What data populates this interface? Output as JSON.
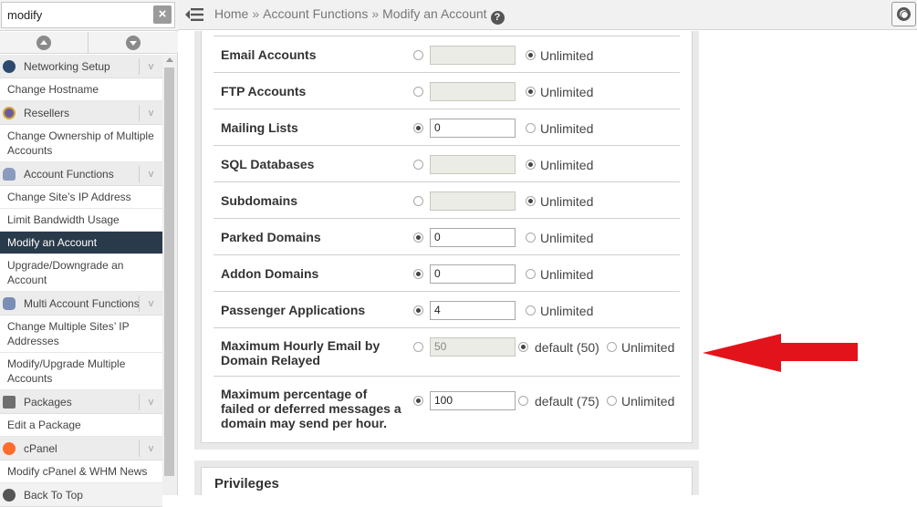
{
  "search": {
    "value": "modify",
    "clear_label": "×"
  },
  "nav": {
    "groups": [
      {
        "label": "Networking Setup",
        "icon": "networking-icon",
        "items": [
          "Change Hostname"
        ]
      },
      {
        "label": "Resellers",
        "icon": "resellers-icon",
        "items": [
          "Change Ownership of Multiple Accounts"
        ]
      },
      {
        "label": "Account Functions",
        "icon": "account-functions-icon",
        "items": [
          "Change Site’s IP Address",
          "Limit Bandwidth Usage",
          "Modify an Account",
          "Upgrade/Downgrade an Account"
        ]
      },
      {
        "label": "Multi Account Functions",
        "icon": "multi-account-icon",
        "items": [
          "Change Multiple Sites’ IP Addresses",
          "Modify/Upgrade Multiple Accounts"
        ]
      },
      {
        "label": "Packages",
        "icon": "packages-icon",
        "items": [
          "Edit a Package"
        ]
      },
      {
        "label": "cPanel",
        "icon": "cpanel-icon",
        "items": [
          "Modify cPanel & WHM News"
        ]
      }
    ],
    "active_item": "Modify an Account",
    "back_to_top": "Back To Top",
    "chevron": "v"
  },
  "breadcrumb": {
    "home": "Home",
    "section": "Account Functions",
    "page": "Modify an Account",
    "sep": "»",
    "help": "?"
  },
  "rows": [
    {
      "label": "Email Accounts",
      "choice": "unlimited",
      "value": "",
      "unlimited": "Unlimited"
    },
    {
      "label": "FTP Accounts",
      "choice": "unlimited",
      "value": "",
      "unlimited": "Unlimited"
    },
    {
      "label": "Mailing Lists",
      "choice": "value",
      "value": "0",
      "unlimited": "Unlimited"
    },
    {
      "label": "SQL Databases",
      "choice": "unlimited",
      "value": "",
      "unlimited": "Unlimited"
    },
    {
      "label": "Subdomains",
      "choice": "unlimited",
      "value": "",
      "unlimited": "Unlimited"
    },
    {
      "label": "Parked Domains",
      "choice": "value",
      "value": "0",
      "unlimited": "Unlimited"
    },
    {
      "label": "Addon Domains",
      "choice": "value",
      "value": "0",
      "unlimited": "Unlimited"
    },
    {
      "label": "Passenger Applications",
      "choice": "value",
      "value": "4",
      "unlimited": "Unlimited"
    }
  ],
  "email_relay": {
    "label_line1": "Maximum Hourly Email by",
    "label_line2": "Domain Relayed",
    "value": "50",
    "default_label": "default (50)",
    "unlimited": "Unlimited",
    "choice": "default"
  },
  "failed_pct": {
    "label_line1": "Maximum percentage of",
    "label_line2": "failed or deferred messages a",
    "label_line3": "domain may send per hour.",
    "value": "100",
    "default_label": "default (75)",
    "unlimited": "Unlimited",
    "choice": "value"
  },
  "privileges": {
    "title": "Privileges"
  },
  "colors": {
    "active_nav": "#293a4a",
    "arrow": "#e3131b",
    "cpanel_orange": "#ff6c2c"
  }
}
